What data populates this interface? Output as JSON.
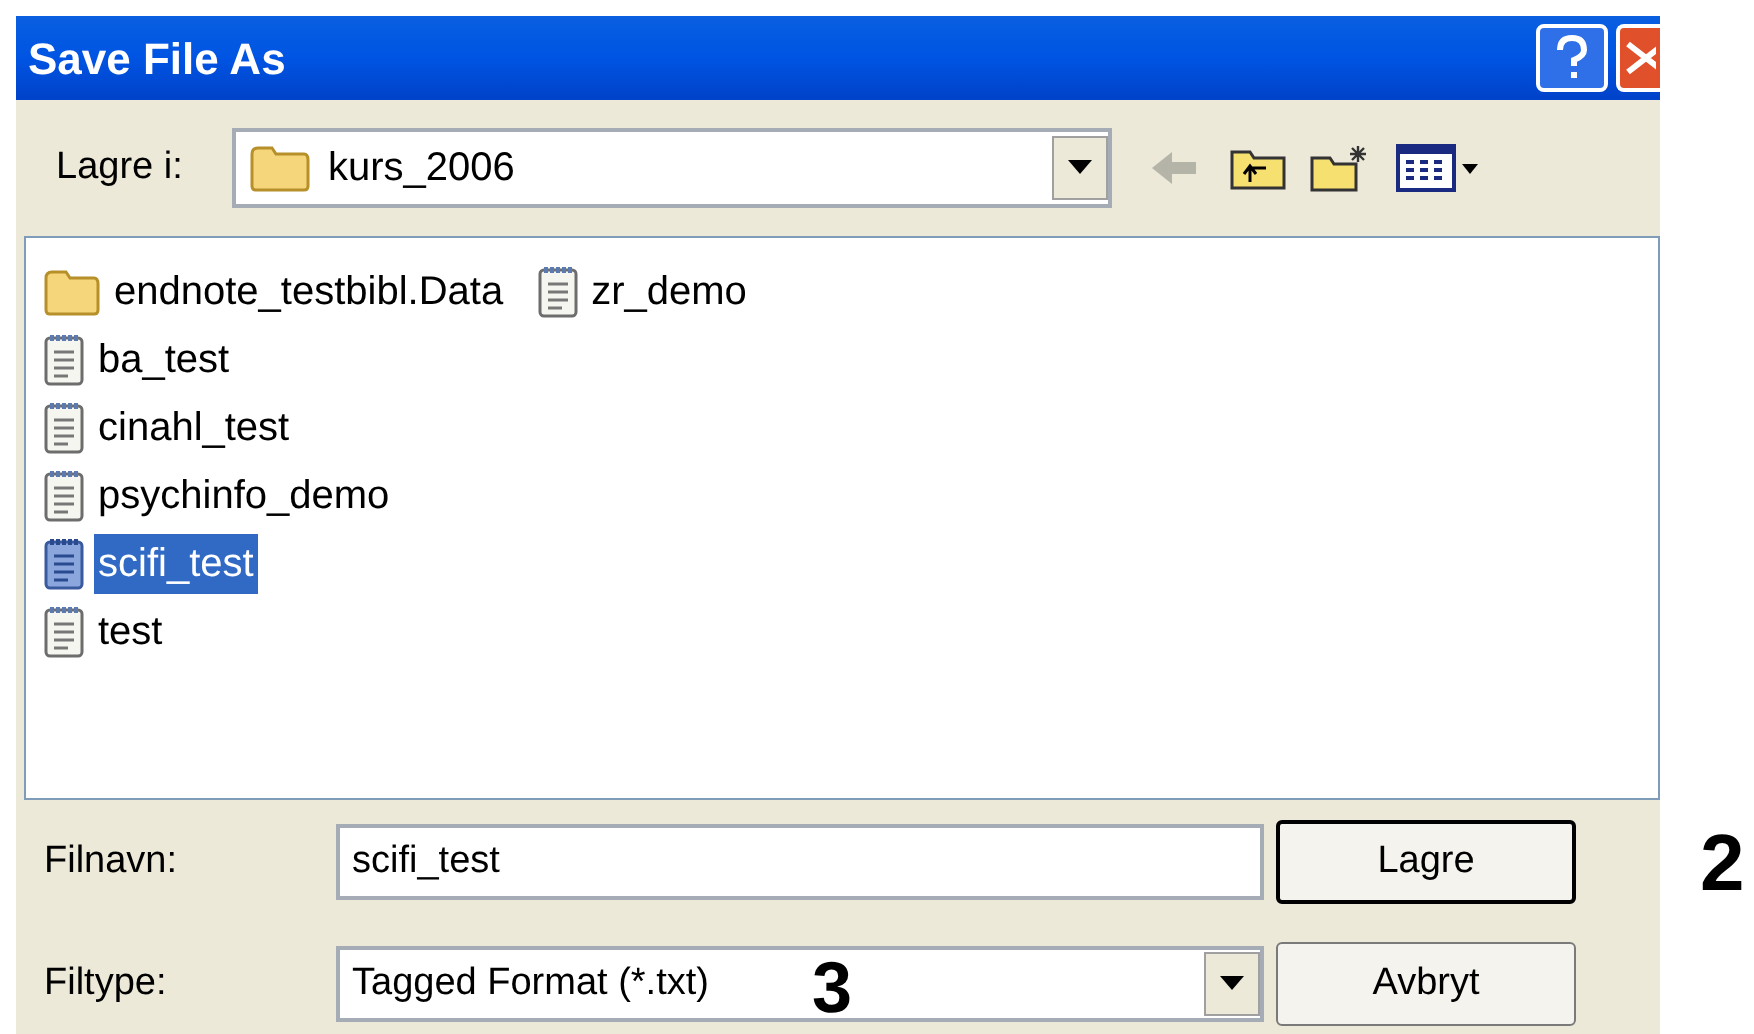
{
  "window": {
    "title": "Save File As"
  },
  "toolbar": {
    "label": "Lagre i:",
    "folder": "kurs_2006"
  },
  "files": [
    {
      "name": "endnote_testbibl.Data",
      "kind": "folder",
      "selected": false
    },
    {
      "name": "ba_test",
      "kind": "document",
      "selected": false
    },
    {
      "name": "cinahl_test",
      "kind": "document",
      "selected": false
    },
    {
      "name": "psychinfo_demo",
      "kind": "document",
      "selected": false
    },
    {
      "name": "scifi_test",
      "kind": "document",
      "selected": true
    },
    {
      "name": "test",
      "kind": "document",
      "selected": false
    },
    {
      "name": "zr_demo",
      "kind": "document",
      "selected": false
    }
  ],
  "filename": {
    "label": "Filnavn:",
    "value": "scifi_test"
  },
  "filetype": {
    "label": "Filtype:",
    "value": "Tagged Format (*.txt)"
  },
  "buttons": [
    "Lagre",
    "Avbryt"
  ],
  "annotations": [
    "2",
    "3"
  ]
}
